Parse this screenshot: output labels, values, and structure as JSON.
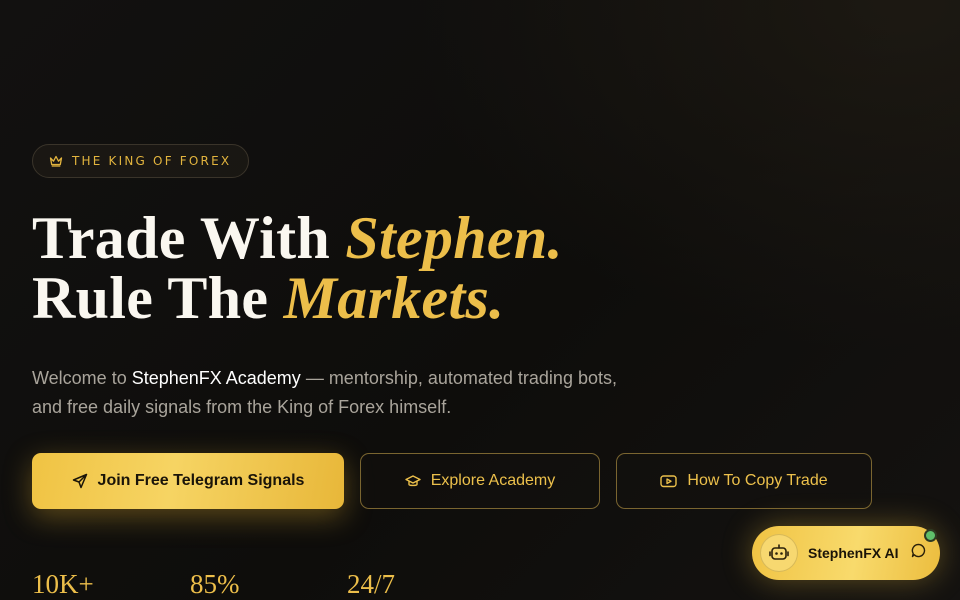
{
  "badge": {
    "icon": "crown-icon",
    "label": "THE KING OF FOREX"
  },
  "headline": {
    "line1_plain": "Trade With ",
    "line1_accent": "Stephen.",
    "line2_plain": "Rule The ",
    "line2_accent": "Markets."
  },
  "lead": {
    "prefix": "Welcome to ",
    "brand": "StephenFX Academy",
    "suffix": " — mentorship, automated trading bots, and free daily signals from the King of Forex himself."
  },
  "cta": {
    "primary": {
      "label": "Join Free Telegram Signals",
      "icon": "send-icon"
    },
    "academy": {
      "label": "Explore Academy",
      "icon": "graduation-cap-icon"
    },
    "copy_trade": {
      "label": "How To Copy Trade",
      "icon": "play-icon"
    }
  },
  "stats": [
    "10K+",
    "85%",
    "24/7"
  ],
  "ai_chat": {
    "label": "StephenFX AI",
    "avatar_icon": "robot-icon",
    "chat_icon": "chat-bubble-icon",
    "status": "online"
  },
  "colors": {
    "background": "#0f0e0c",
    "accent_gold": "#ecbe4a",
    "text": "#faf7f0",
    "muted": "#a9a49b",
    "online": "#5fbf6a"
  }
}
